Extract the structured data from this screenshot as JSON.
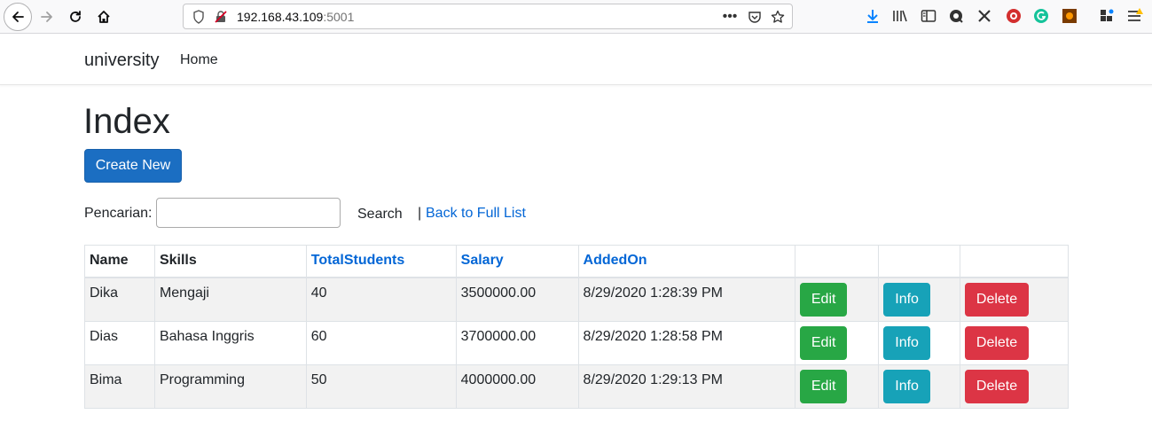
{
  "browser": {
    "url_host": "192.168.43.109",
    "url_port": ":5001"
  },
  "navbar": {
    "brand": "university",
    "home_link": "Home"
  },
  "page": {
    "title": "Index",
    "create_button": "Create New"
  },
  "search": {
    "label": "Pencarian:",
    "input_value": "",
    "button": "Search",
    "separator": "|",
    "back_link": "Back to Full List"
  },
  "table": {
    "headers": [
      "Name",
      "Skills",
      "TotalStudents",
      "Salary",
      "AddedOn"
    ],
    "rows": [
      {
        "name": "Dika",
        "skills": "Mengaji",
        "total": "40",
        "salary": "3500000.00",
        "added": "8/29/2020 1:28:39 PM",
        "edit": "Edit",
        "info": "Info",
        "delete": "Delete"
      },
      {
        "name": "Dias",
        "skills": "Bahasa Inggris",
        "total": "60",
        "salary": "3700000.00",
        "added": "8/29/2020 1:28:58 PM",
        "edit": "Edit",
        "info": "Info",
        "delete": "Delete"
      },
      {
        "name": "Bima",
        "skills": "Programming",
        "total": "50",
        "salary": "4000000.00",
        "added": "8/29/2020 1:29:13 PM",
        "edit": "Edit",
        "info": "Info",
        "delete": "Delete"
      }
    ]
  },
  "colors": {
    "primary": "#1b6ec2",
    "edit": "#28a745",
    "info": "#17a2b8",
    "delete": "#dc3545",
    "link": "#0366d6"
  }
}
